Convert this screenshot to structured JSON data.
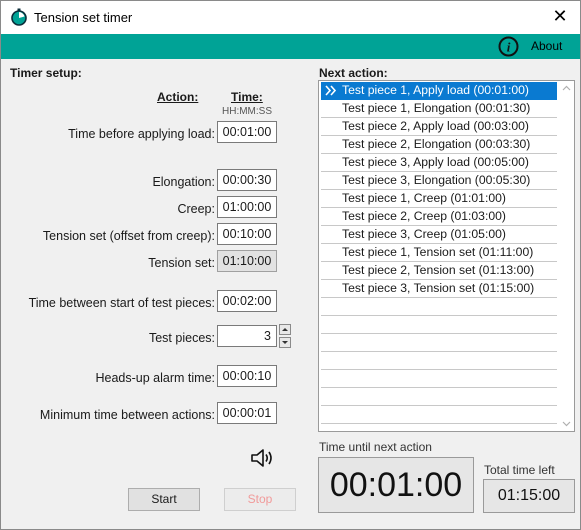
{
  "window": {
    "title": "Tension set timer",
    "close_glyph": "✕",
    "accent_color": "#00a396"
  },
  "toolbar": {
    "info_icon": "info-icon",
    "about_label": "About"
  },
  "timer_setup": {
    "title": "Timer setup:",
    "action_header": "Action:",
    "time_header": "Time:",
    "time_format": "HH:MM:SS",
    "rows": [
      {
        "label": "Time before applying load:",
        "value": "00:01:00",
        "readonly": false
      },
      {
        "label": "Elongation:",
        "value": "00:00:30",
        "readonly": false
      },
      {
        "label": "Creep:",
        "value": "01:00:00",
        "readonly": false
      },
      {
        "label": "Tension set (offset from creep):",
        "value": "00:10:00",
        "readonly": false
      },
      {
        "label": "Tension set:",
        "value": "01:10:00",
        "readonly": true
      },
      {
        "label": "Time between start of test pieces:",
        "value": "00:02:00",
        "readonly": false
      },
      {
        "label": "Test pieces:",
        "value": "3",
        "readonly": false
      },
      {
        "label": "Heads-up alarm time:",
        "value": "00:00:10",
        "readonly": false
      },
      {
        "label": "Minimum time between actions:",
        "value": "00:00:01",
        "readonly": false
      }
    ],
    "sound_icon": "speaker-icon",
    "start_label": "Start",
    "stop_label": "Stop"
  },
  "next_action": {
    "title": "Next action:",
    "items": [
      "Test piece 1, Apply load (00:01:00)",
      "Test piece 1, Elongation (00:01:30)",
      "Test piece 2, Apply load (00:03:00)",
      "Test piece 2, Elongation (00:03:30)",
      "Test piece 3, Apply load (00:05:00)",
      "Test piece 3, Elongation (00:05:30)",
      "Test piece 1, Creep (01:01:00)",
      "Test piece 2, Creep (01:03:00)",
      "Test piece 3, Creep (01:05:00)",
      "Test piece 1, Tension set (01:11:00)",
      "Test piece 2, Tension set (01:13:00)",
      "Test piece 3, Tension set (01:15:00)"
    ],
    "selected_index": 0,
    "selection_color": "#0a7ad1"
  },
  "status": {
    "time_until_label": "Time until next action",
    "time_until_value": "00:01:00",
    "total_label": "Total time left",
    "total_value": "01:15:00"
  }
}
